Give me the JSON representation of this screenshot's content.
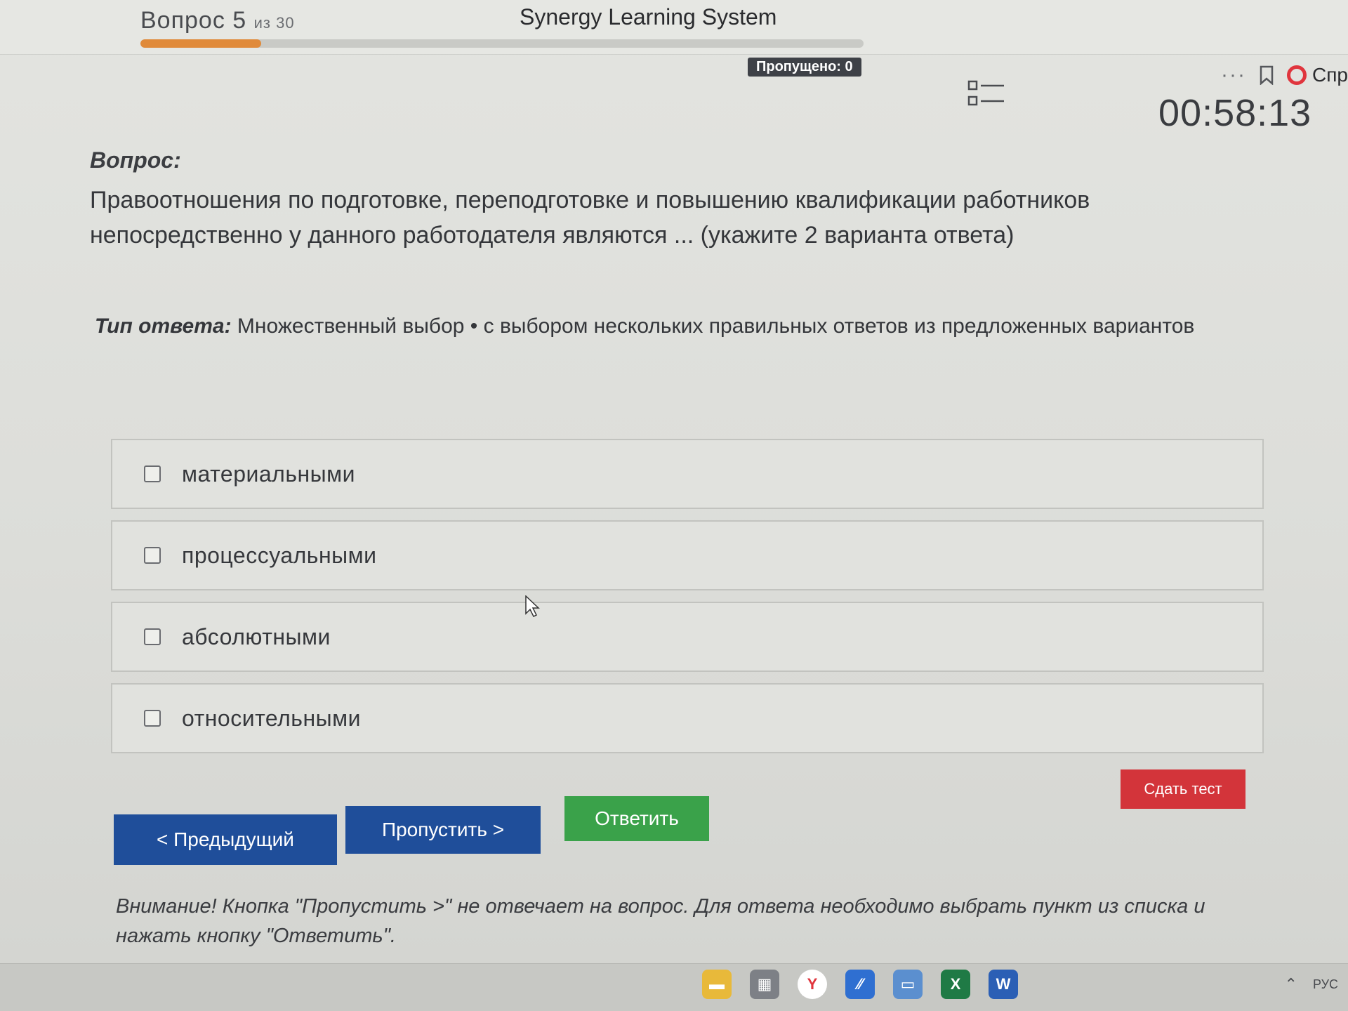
{
  "window": {
    "title": "Synergy Learning System"
  },
  "progress": {
    "label": "Вопрос 5",
    "of_text": "из 30",
    "current": 5,
    "total": 30,
    "skipped_badge": "Пропущено: 0"
  },
  "header": {
    "timer": "00:58:13",
    "help_label": "Спр",
    "more_label": "···"
  },
  "question": {
    "label": "Вопрос:",
    "text": "Правоотношения по подготовке, переподготовке и повышению квалификации работников непосредственно у данного работодателя являются ... (укажите 2 варианта ответа)"
  },
  "answer_type": {
    "label": "Тип ответа:",
    "value": "Множественный выбор • с выбором нескольких правильных ответов из предложенных вариантов"
  },
  "options": [
    {
      "label": "материальными",
      "checked": false
    },
    {
      "label": "процессуальными",
      "checked": false
    },
    {
      "label": "абсолютными",
      "checked": false
    },
    {
      "label": "относительными",
      "checked": false
    }
  ],
  "buttons": {
    "prev": "< Предыдущий",
    "skip": "Пропустить >",
    "answer": "Ответить",
    "submit": "Сдать тест"
  },
  "notice": "Внимание! Кнопка \"Пропустить >\" не отвечает на вопрос. Для ответа необходимо выбрать пункт из списка и нажать кнопку \"Ответить\".",
  "taskbar": {
    "icons": [
      "file-explorer-icon",
      "calendar-icon",
      "yandex-browser-icon",
      "app-icon",
      "screen-icon",
      "excel-icon",
      "word-icon"
    ],
    "tray_lang": "РУС"
  },
  "colors": {
    "primary_button": "#1f4e9a",
    "answer_button": "#3aa24a",
    "submit_button": "#d3343a",
    "progress_fill": "#e08a3a"
  }
}
